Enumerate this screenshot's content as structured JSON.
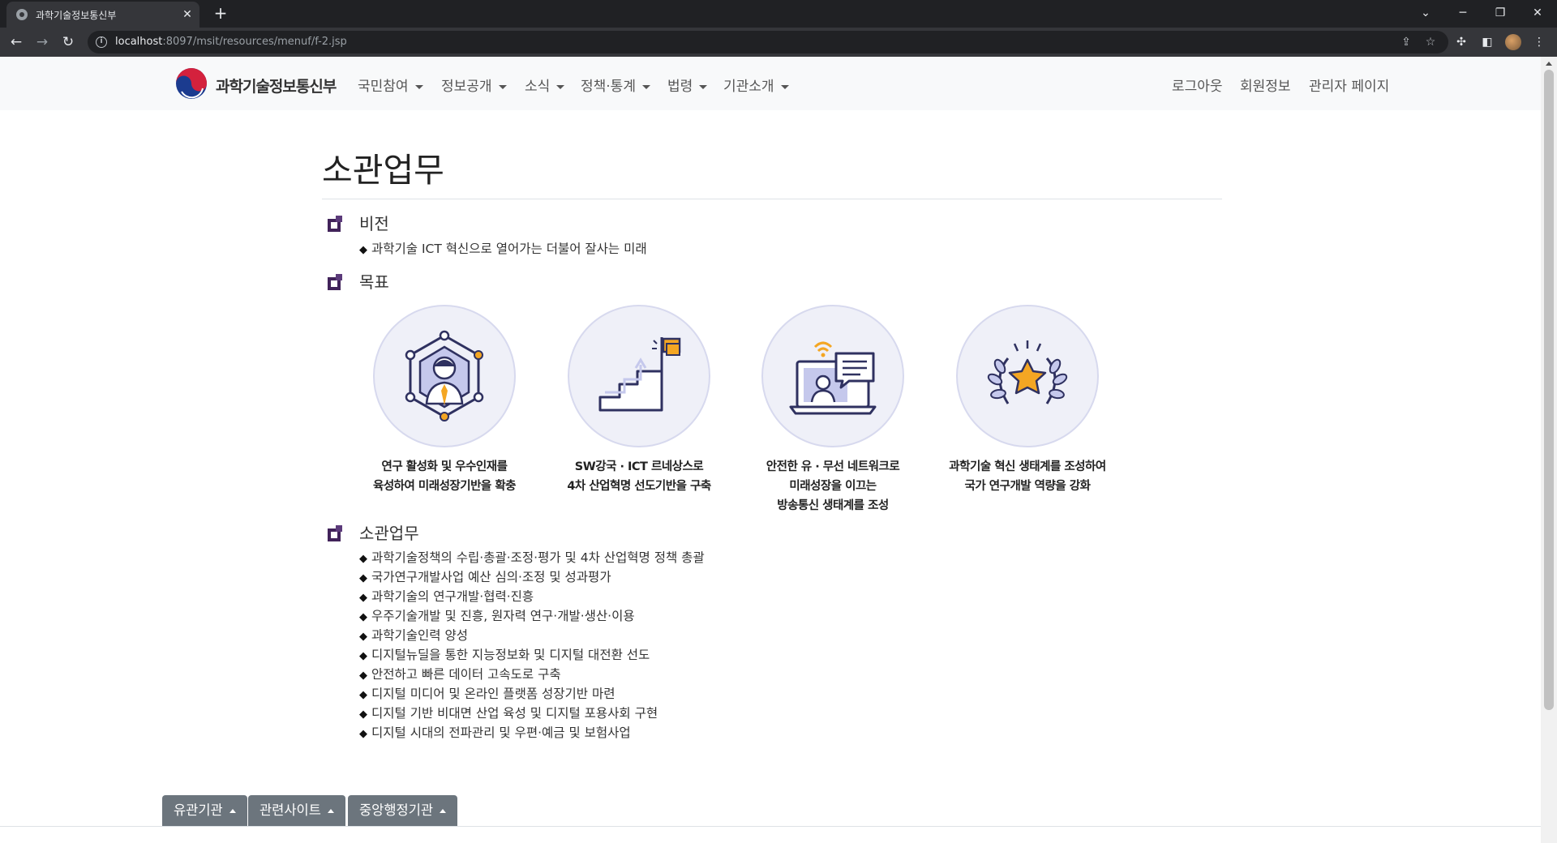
{
  "browser": {
    "tab_title": "과학기술정보통신부",
    "tab_close": "✕",
    "new_tab": "+",
    "url_host": "localhost",
    "url_rest": ":8097/msit/resources/menuf/f-2.jsp"
  },
  "site": {
    "logo_text": "과학기술정보통신부",
    "menu": [
      "국민참여",
      "정보공개",
      "소식",
      "정책·통계",
      "법령",
      "기관소개"
    ],
    "right_links": [
      "로그아웃",
      "회원정보",
      "관리자 페이지"
    ]
  },
  "page": {
    "title": "소관업무",
    "vision": {
      "title": "비전",
      "text": "과학기술 ICT 혁신으로 열어가는 더불어 잘사는 미래"
    },
    "goals": {
      "title": "목표",
      "items": [
        {
          "icon": "person-network-icon",
          "lines": [
            "연구 활성화 및 우수인재를",
            "육성하여 미래성장기반을 확충"
          ]
        },
        {
          "icon": "stairs-flag-icon",
          "lines": [
            "SW강국 · ICT 르네상스로",
            "4차 산업혁명 선도기반을 구축"
          ]
        },
        {
          "icon": "laptop-wifi-icon",
          "lines": [
            "안전한 유 · 무선 네트워크로",
            "미래성장을 이끄는",
            "방송통신 생태계를 조성"
          ]
        },
        {
          "icon": "laurel-star-icon",
          "lines": [
            "과학기술 혁신 생태계를 조성하여",
            "국가 연구개발 역량을 강화"
          ]
        }
      ]
    },
    "duties": {
      "title": "소관업무",
      "items": [
        "과학기술정책의 수립·총괄·조정·평가 및 4차 산업혁명 정책 총괄",
        "국가연구개발사업 예산 심의·조정 및 성과평가",
        "과학기술의 연구개발·협력·진흥",
        "우주기술개발 및 진흥, 원자력 연구·개발·생산·이용",
        "과학기술인력 양성",
        "디지털뉴딜을 통한 지능정보화 및 디지털 대전환 선도",
        "안전하고 빠른 데이터 고속도로 구축",
        "디지털 미디어 및 온라인 플랫폼 성장기반 마련",
        "디지털 기반 비대면 산업 육성 및 디지털 포용사회 구현",
        "디지털 시대의 전파관리 및 우편·예금 및 보험사업"
      ]
    }
  },
  "footer": {
    "buttons": [
      "유관기관",
      "관련사이트",
      "중앙행정기관"
    ]
  },
  "colors": {
    "section_icon": "#41235a",
    "icon_navy": "#2f3160",
    "icon_accent": "#f4a623",
    "circle_bg": "#eff0f8"
  }
}
